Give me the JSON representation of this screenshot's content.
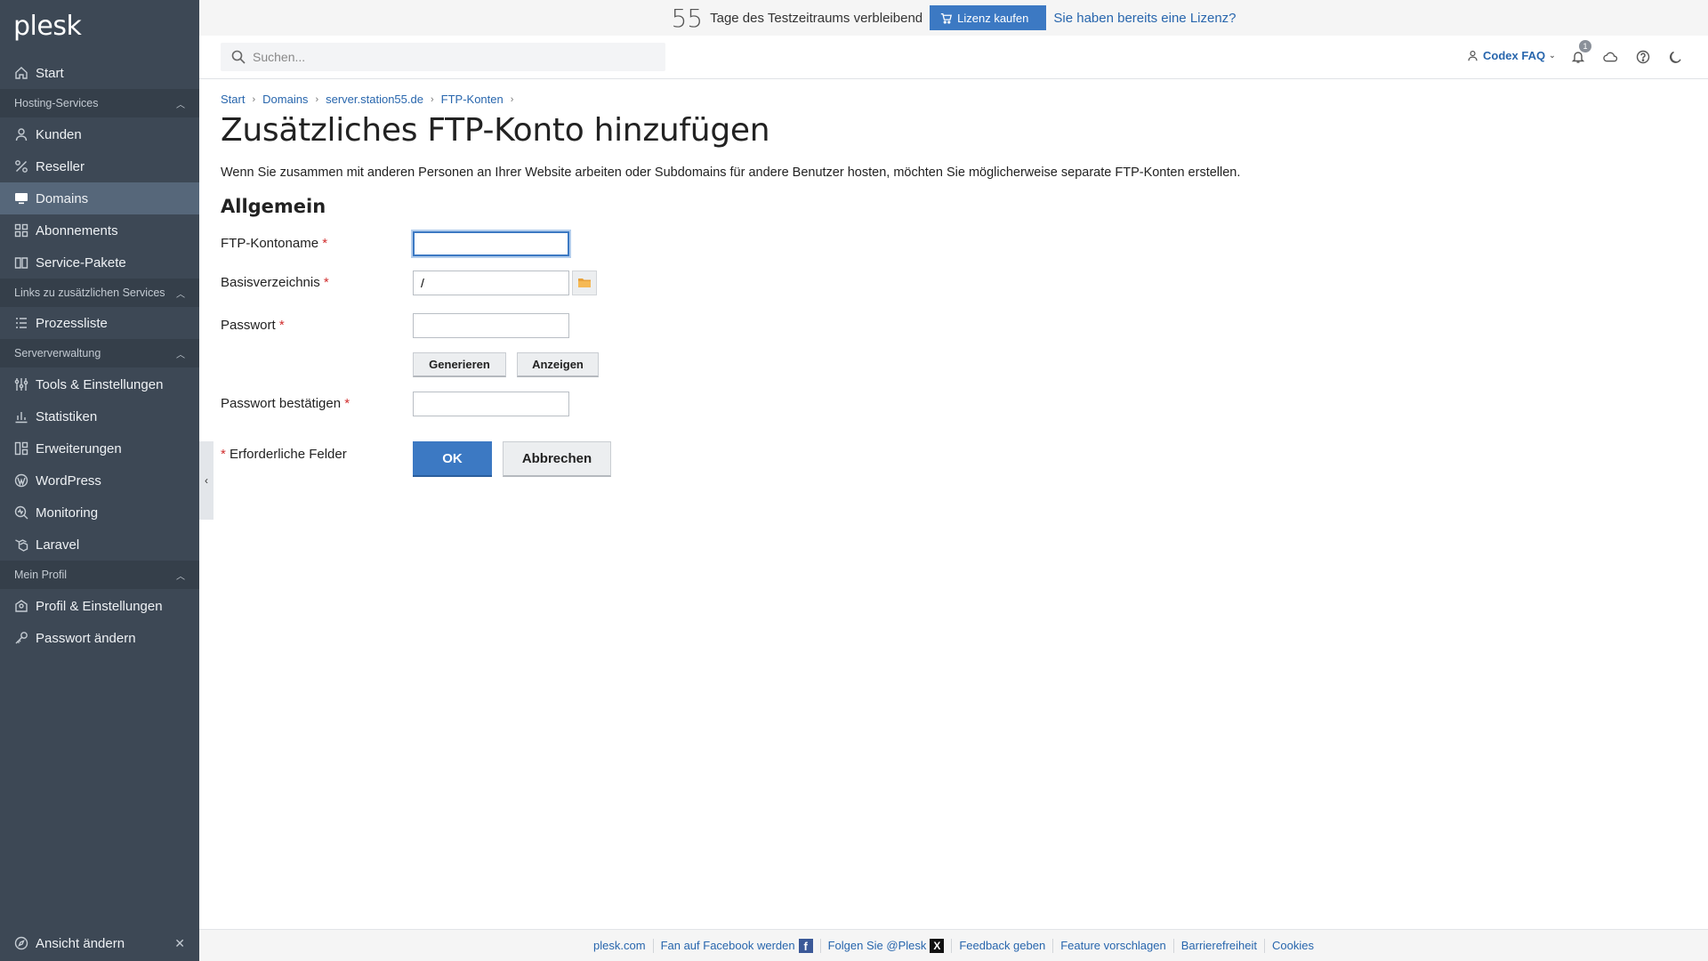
{
  "app": {
    "logo": "plesk"
  },
  "trial": {
    "days": "55",
    "text": "Tage des Testzeitraums verbleibend",
    "buy_label": "Lizenz kaufen",
    "have_license": "Sie haben bereits eine Lizenz?"
  },
  "header": {
    "search_placeholder": "Suchen...",
    "user": "Codex FAQ",
    "notifications_count": "1"
  },
  "sidebar": {
    "start": "Start",
    "sections": [
      {
        "label": "Hosting-Services"
      },
      {
        "label": "Links zu zusätzlichen Services"
      },
      {
        "label": "Serververwaltung"
      },
      {
        "label": "Mein Profil"
      }
    ],
    "items": {
      "kunden": "Kunden",
      "reseller": "Reseller",
      "domains": "Domains",
      "abonnements": "Abonnements",
      "service_pakete": "Service-Pakete",
      "prozessliste": "Prozessliste",
      "tools": "Tools & Einstellungen",
      "statistiken": "Statistiken",
      "erweiterungen": "Erweiterungen",
      "wordpress": "WordPress",
      "monitoring": "Monitoring",
      "laravel": "Laravel",
      "profil": "Profil & Einstellungen",
      "passwort": "Passwort ändern"
    },
    "bottom": "Ansicht ändern",
    "active": "Domains"
  },
  "breadcrumb": [
    "Start",
    "Domains",
    "server.station55.de",
    "FTP-Konten"
  ],
  "page": {
    "title": "Zusätzliches FTP-Konto hinzufügen",
    "description": "Wenn Sie zusammen mit anderen Personen an Ihrer Website arbeiten oder Subdomains für andere Benutzer hosten, möchten Sie möglicherweise separate FTP-Konten erstellen.",
    "section": "Allgemein"
  },
  "form": {
    "account_name_label": "FTP-Kontoname",
    "account_name_value": "",
    "home_dir_label": "Basisverzeichnis",
    "home_dir_value": "/",
    "password_label": "Passwort",
    "password_value": "",
    "generate_label": "Generieren",
    "show_label": "Anzeigen",
    "confirm_label": "Passwort bestätigen",
    "confirm_value": "",
    "required_note": "Erforderliche Felder",
    "required_mark": "*",
    "ok_label": "OK",
    "cancel_label": "Abbrechen"
  },
  "footer": {
    "links": [
      "plesk.com",
      "Fan auf Facebook werden",
      "Folgen Sie @Plesk",
      "Feedback geben",
      "Feature vorschlagen",
      "Barrierefreiheit",
      "Cookies"
    ]
  },
  "colors": {
    "sidebar_bg": "#3d4855",
    "sidebar_active": "#56677a",
    "accent": "#3c79c3",
    "link": "#2866ad",
    "required": "#d02d2d"
  }
}
